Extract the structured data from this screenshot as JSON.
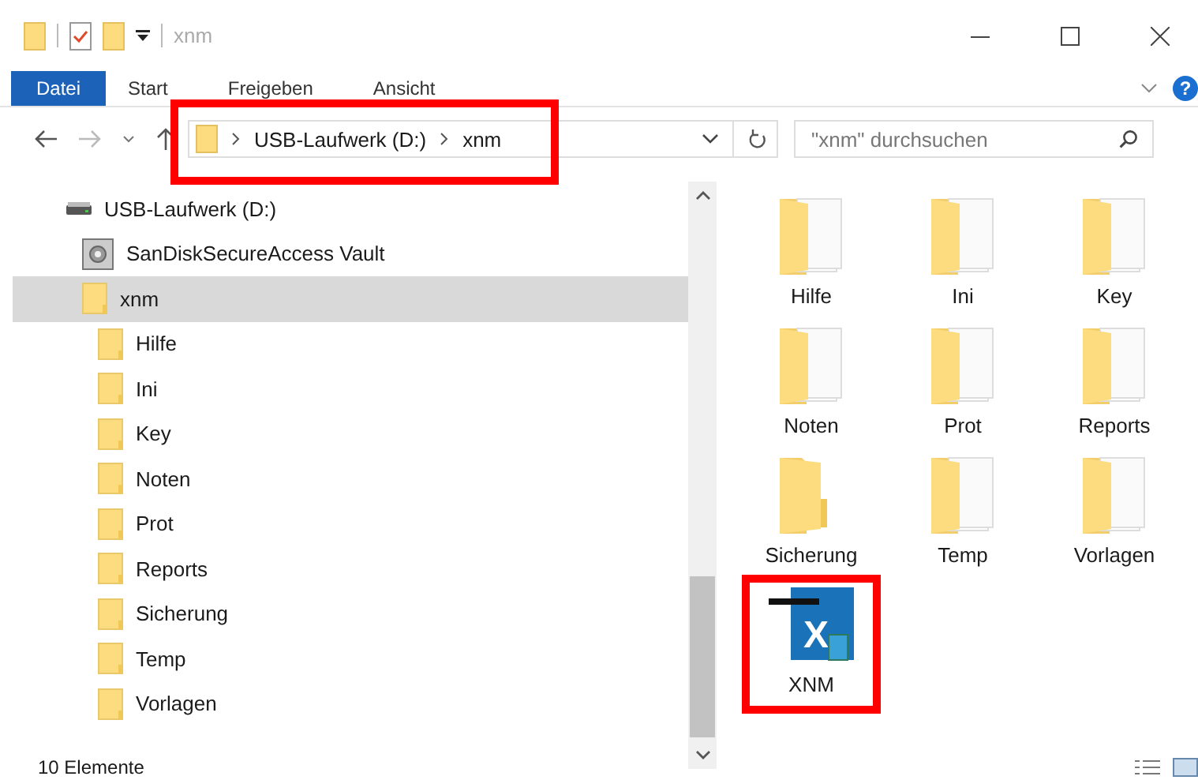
{
  "window": {
    "title": "xnm"
  },
  "ribbon": {
    "tabs": [
      {
        "label": "Datei",
        "kind": "file",
        "selected": false
      },
      {
        "label": "Start",
        "kind": "tab",
        "selected": false
      },
      {
        "label": "Freigeben",
        "kind": "tab",
        "selected": false
      },
      {
        "label": "Ansicht",
        "kind": "tab",
        "selected": false
      }
    ],
    "help": "?"
  },
  "address_bar": {
    "crumbs": [
      "USB-Laufwerk (D:)",
      "xnm"
    ],
    "highlighted": true
  },
  "search": {
    "placeholder": "\"xnm\" durchsuchen"
  },
  "tree": [
    {
      "label": "USB-Laufwerk (D:)",
      "kind": "drive",
      "selected": false,
      "children": [
        {
          "label": "SanDiskSecureAccess Vault",
          "kind": "vault",
          "selected": false
        },
        {
          "label": "xnm",
          "kind": "folder",
          "selected": true,
          "children": [
            {
              "label": "Hilfe",
              "kind": "folder",
              "selected": false
            },
            {
              "label": "Ini",
              "kind": "folder",
              "selected": false
            },
            {
              "label": "Key",
              "kind": "folder",
              "selected": false
            },
            {
              "label": "Noten",
              "kind": "folder",
              "selected": false
            },
            {
              "label": "Prot",
              "kind": "folder",
              "selected": false
            },
            {
              "label": "Reports",
              "kind": "folder",
              "selected": false
            },
            {
              "label": "Sicherung",
              "kind": "folder",
              "selected": false
            },
            {
              "label": "Temp",
              "kind": "folder",
              "selected": false
            },
            {
              "label": "Vorlagen",
              "kind": "folder",
              "selected": false
            }
          ]
        }
      ]
    }
  ],
  "files": [
    {
      "name": "Hilfe",
      "kind": "folder",
      "highlighted": false
    },
    {
      "name": "Ini",
      "kind": "folder",
      "highlighted": false
    },
    {
      "name": "Key",
      "kind": "folder",
      "highlighted": false
    },
    {
      "name": "Noten",
      "kind": "folder",
      "highlighted": false
    },
    {
      "name": "Prot",
      "kind": "folder",
      "highlighted": false
    },
    {
      "name": "Reports",
      "kind": "folder",
      "highlighted": false
    },
    {
      "name": "Sicherung",
      "kind": "empty-folder",
      "highlighted": false
    },
    {
      "name": "Temp",
      "kind": "folder",
      "highlighted": false
    },
    {
      "name": "Vorlagen",
      "kind": "folder",
      "highlighted": false
    },
    {
      "name": "XNM",
      "kind": "app",
      "icon_letter": "X",
      "highlighted": true
    }
  ],
  "status_bar": {
    "count": "10 Elemente"
  }
}
